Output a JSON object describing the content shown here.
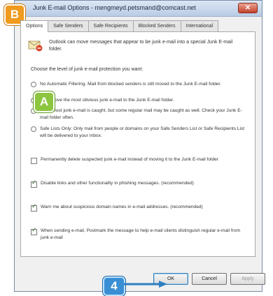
{
  "window": {
    "title": "Junk E-mail Options - mengmeyd.petsmand@comcast.net",
    "close_glyph": "✕"
  },
  "tabs": [
    "Options",
    "Safe Senders",
    "Safe Recipients",
    "Blocked Senders",
    "International"
  ],
  "options_panel": {
    "intro_text": "Outlook can move messages that appear to be junk e-mail into a special Junk E-mail folder.",
    "choose_label": "Choose the level of junk e-mail protection you want:",
    "levels": [
      {
        "label": "No Automatic Filtering. Mail from blocked senders is still moved to the Junk E-mail folder.",
        "checked": false
      },
      {
        "label": "Low: Move the most obvious junk e-mail to the Junk E-mail folder.",
        "checked": true
      },
      {
        "label": "High: Most junk e-mail is caught, but some regular mail may be caught as well. Check your Junk E-mail folder often.",
        "checked": false
      },
      {
        "label": "Safe Lists Only: Only mail from people or domains on your Safe Senders List or Safe Recipients List will be delivered to your Inbox.",
        "checked": false
      }
    ],
    "checkboxes": [
      {
        "label": "Permanently delete suspected junk e-mail instead of moving it to the Junk E-mail folder",
        "checked": false
      },
      {
        "label": "Disable links and other functionality in phishing messages. (recommended)",
        "checked": true
      },
      {
        "label": "Warn me about suspicious domain names in e-mail addresses. (recommended)",
        "checked": true
      },
      {
        "label": "When sending e-mail, Postmark the message to help e-mail clients distinguish regular e-mail from junk e-mail",
        "checked": true
      }
    ]
  },
  "buttons": {
    "ok": "OK",
    "cancel": "Cancel",
    "apply": "Apply"
  },
  "callouts": {
    "b": "B",
    "a": "A",
    "step": "4"
  },
  "colors": {
    "callout_b": "#f09a1e",
    "callout_a": "#8cc63f",
    "callout_step": "#3a8fd4"
  },
  "icons": {
    "intro": "junk-mail-envelope-icon"
  }
}
